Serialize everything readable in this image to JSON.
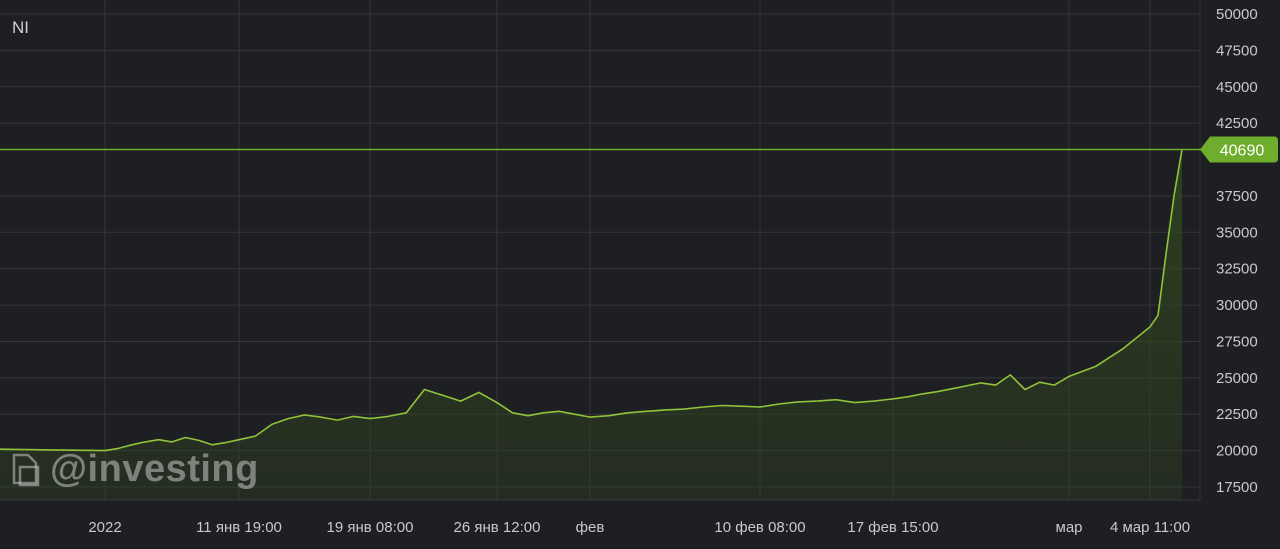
{
  "chart_data": {
    "type": "area",
    "symbol": "NI",
    "title": "",
    "xlabel": "",
    "ylabel": "",
    "ylim": [
      16500,
      50500
    ],
    "y_ticks": [
      17500,
      20000,
      22500,
      25000,
      27500,
      30000,
      32500,
      35000,
      37500,
      42500,
      45000,
      47500,
      50000
    ],
    "x_tick_labels": [
      "2022",
      "11 янв 19:00",
      "19 янв 08:00",
      "26 янв 12:00",
      "фев",
      "10 фев 08:00",
      "17 фев 15:00",
      "мар",
      "4 мар 11:00"
    ],
    "current_price_label": "40690",
    "current_price": 40690,
    "grid": true,
    "colors": {
      "line": "#8fc43a",
      "fill": "#2f4420",
      "price_tag": "#6fae2c",
      "background": "#1e1f22",
      "grid": "#34363a"
    },
    "x": [
      "2021-12-30",
      "2021-12-31",
      "2022-01-01",
      "2022-01-02",
      "2022-01-03",
      "2022-01-04",
      "2022-01-05",
      "2022-01-06",
      "2022-01-07",
      "2022-01-08",
      "2022-01-09",
      "2022-01-10",
      "2022-01-11",
      "2022-01-12",
      "2022-01-13",
      "2022-01-14",
      "2022-01-15",
      "2022-01-16",
      "2022-01-17",
      "2022-01-18",
      "2022-01-19",
      "2022-01-20",
      "2022-01-21",
      "2022-01-22",
      "2022-01-23",
      "2022-01-24",
      "2022-01-25",
      "2022-01-26",
      "2022-01-27",
      "2022-01-28",
      "2022-01-29",
      "2022-01-30",
      "2022-01-31",
      "2022-02-01",
      "2022-02-02",
      "2022-02-03",
      "2022-02-04",
      "2022-02-05",
      "2022-02-06",
      "2022-02-07",
      "2022-02-08",
      "2022-02-09",
      "2022-02-10",
      "2022-02-11",
      "2022-02-12",
      "2022-02-13",
      "2022-02-14",
      "2022-02-15",
      "2022-02-16",
      "2022-02-17",
      "2022-02-18",
      "2022-02-19",
      "2022-02-20",
      "2022-02-21",
      "2022-02-22",
      "2022-02-23",
      "2022-02-24",
      "2022-02-25",
      "2022-02-26",
      "2022-02-27",
      "2022-02-28",
      "2022-03-01",
      "2022-03-02",
      "2022-03-03",
      "2022-03-04",
      "2022-03-05",
      "2022-03-06",
      "2022-03-07",
      "2022-03-08"
    ],
    "series": [
      {
        "values": [
          20100,
          20050,
          20000,
          20150,
          20400,
          20600,
          20750,
          20600,
          20900,
          20700,
          20400,
          20550,
          20750,
          21000,
          21800,
          22200,
          22450,
          22300,
          22100,
          22350,
          22200,
          22350,
          22600,
          24200,
          23800,
          23400,
          24000,
          23300,
          22600,
          22400,
          22600,
          22700,
          22500,
          22300,
          22400,
          22600,
          22700,
          22800,
          22850,
          23000,
          23100,
          23050,
          23000,
          23200,
          23350,
          23400,
          23500,
          23300,
          23400,
          23550,
          23700,
          23900,
          24050,
          24250,
          24450,
          24650,
          24500,
          25200,
          24200,
          24700,
          24500,
          25100,
          25800,
          27000,
          28500,
          29300,
          33500,
          37500,
          40690
        ]
      }
    ]
  },
  "watermark": {
    "text": "@investing",
    "icon": "investing-logo-icon"
  }
}
